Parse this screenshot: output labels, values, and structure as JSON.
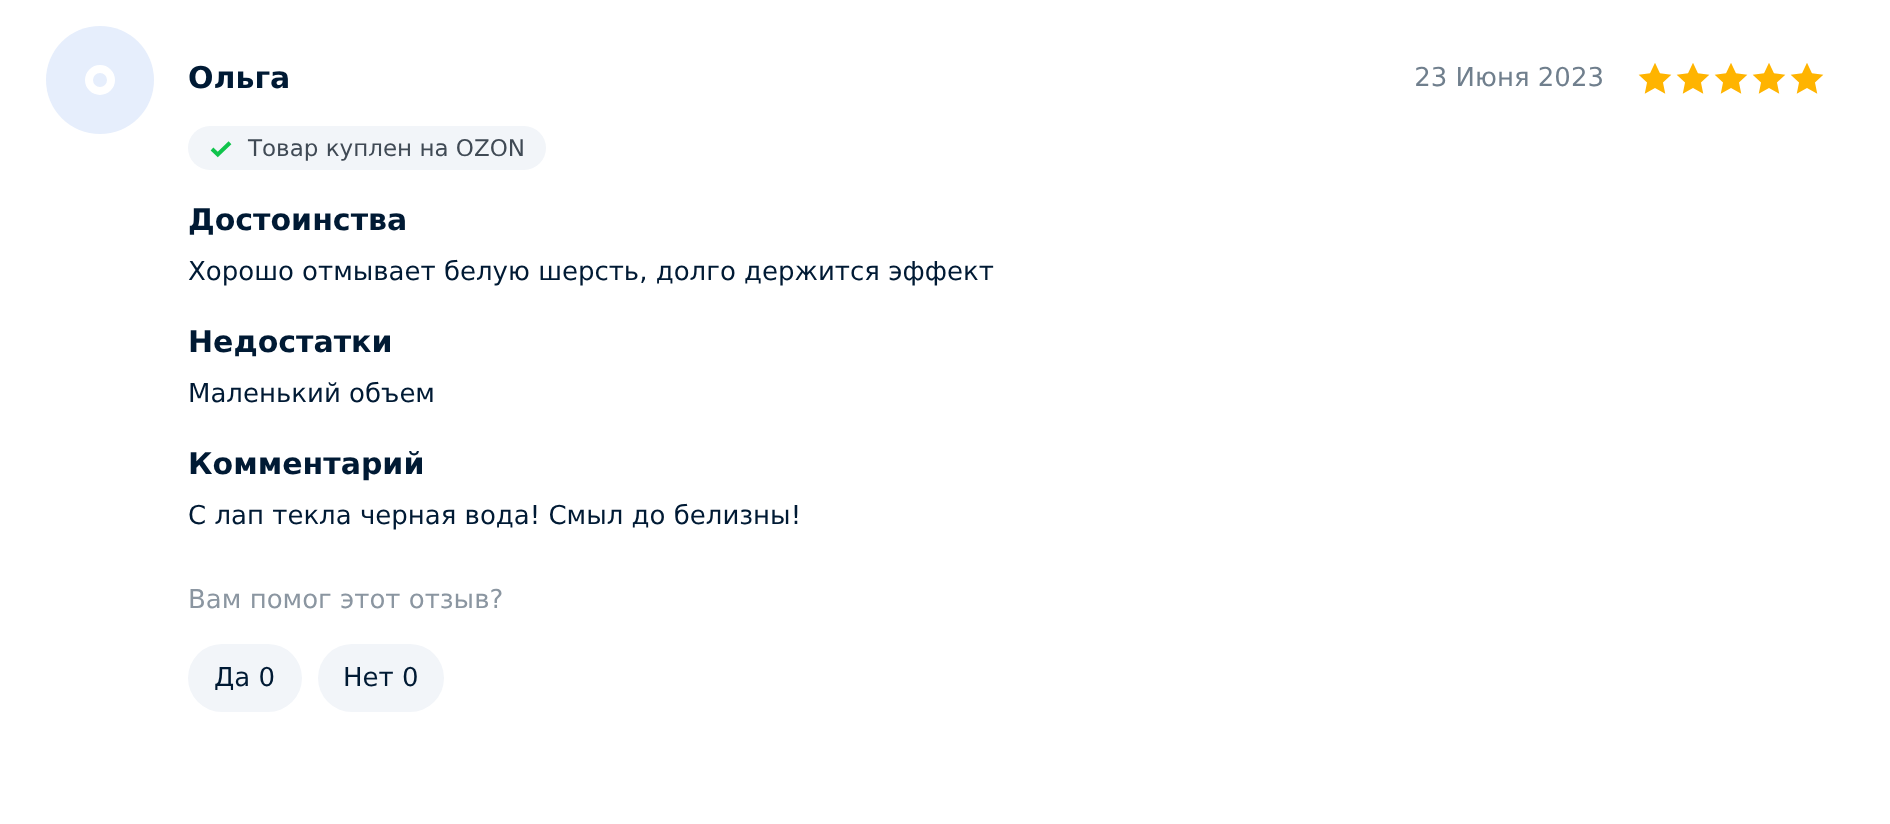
{
  "review": {
    "author": "Ольга",
    "date": "23 Июня 2023",
    "stars": 5,
    "badge": {
      "text": "Товар куплен на OZON",
      "verified": true
    },
    "sections": [
      {
        "heading": "Достоинства",
        "text": "Хорошо отмывает белую шерсть, долго держится эффект"
      },
      {
        "heading": "Недостатки",
        "text": "Маленький объем"
      },
      {
        "heading": "Комментарий",
        "text": "С лап текла черная вода! Смыл до белизны!"
      }
    ],
    "helpful": {
      "question": "Вам помог этот отзыв?",
      "buttons": [
        "Да 0",
        "Нет 0"
      ]
    }
  }
}
